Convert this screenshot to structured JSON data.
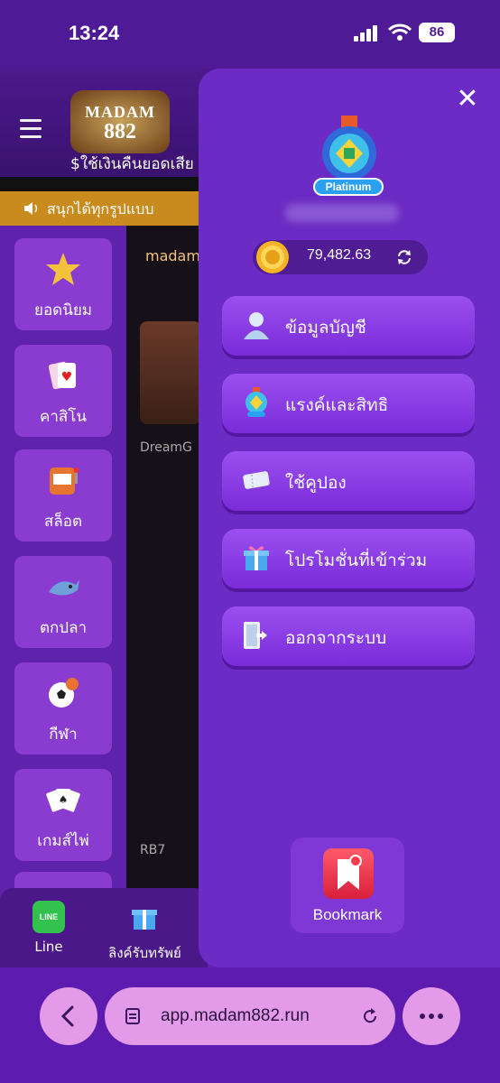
{
  "status_bar": {
    "time": "13:24",
    "battery": "86"
  },
  "background_app": {
    "logo_line1": "MADAM",
    "logo_line2": "882",
    "bonus_text": "$ใช้เงินคืนยอดเสีย (",
    "marquee_text": "สนุกได้ทุกรูปแบบ",
    "top_row_label": "madam",
    "thumb_label": "DreamG",
    "rb7_label": "RB7",
    "categories": [
      {
        "label": "ยอดนิยม",
        "icon": "star-icon"
      },
      {
        "label": "คาสิโน",
        "icon": "cards-icon"
      },
      {
        "label": "สล็อต",
        "icon": "slot-machine-icon"
      },
      {
        "label": "ตกปลา",
        "icon": "shark-icon"
      },
      {
        "label": "กีฬา",
        "icon": "soccer-ball-icon"
      },
      {
        "label": "เกมส์ไพ่",
        "icon": "playing-cards-icon"
      }
    ],
    "bottom_nav": [
      {
        "label": "Line",
        "icon": "line-icon"
      },
      {
        "label": "ลิงค์รับทรัพย์",
        "icon": "gift-icon"
      }
    ],
    "line_icon_text": "LINE"
  },
  "panel": {
    "rank": "Platinum",
    "balance": "79,482.63",
    "menu": [
      {
        "label": "ข้อมูลบัญชี",
        "icon": "user-icon"
      },
      {
        "label": "แรงค์และสิทธิ",
        "icon": "rank-medal-icon"
      },
      {
        "label": "ใช้คูปอง",
        "icon": "coupon-icon"
      },
      {
        "label": "โปรโมชั่นที่เข้าร่วม",
        "icon": "gift-box-icon"
      },
      {
        "label": "ออกจากระบบ",
        "icon": "logout-icon"
      }
    ],
    "bookmark_label": "Bookmark"
  },
  "browser": {
    "url": "app.madam882.run"
  },
  "colors": {
    "panel": "#6c2bc4",
    "menu_button": "#9b4ff0",
    "browser_pill": "#e39ae8",
    "marquee": "#c98b1e"
  }
}
